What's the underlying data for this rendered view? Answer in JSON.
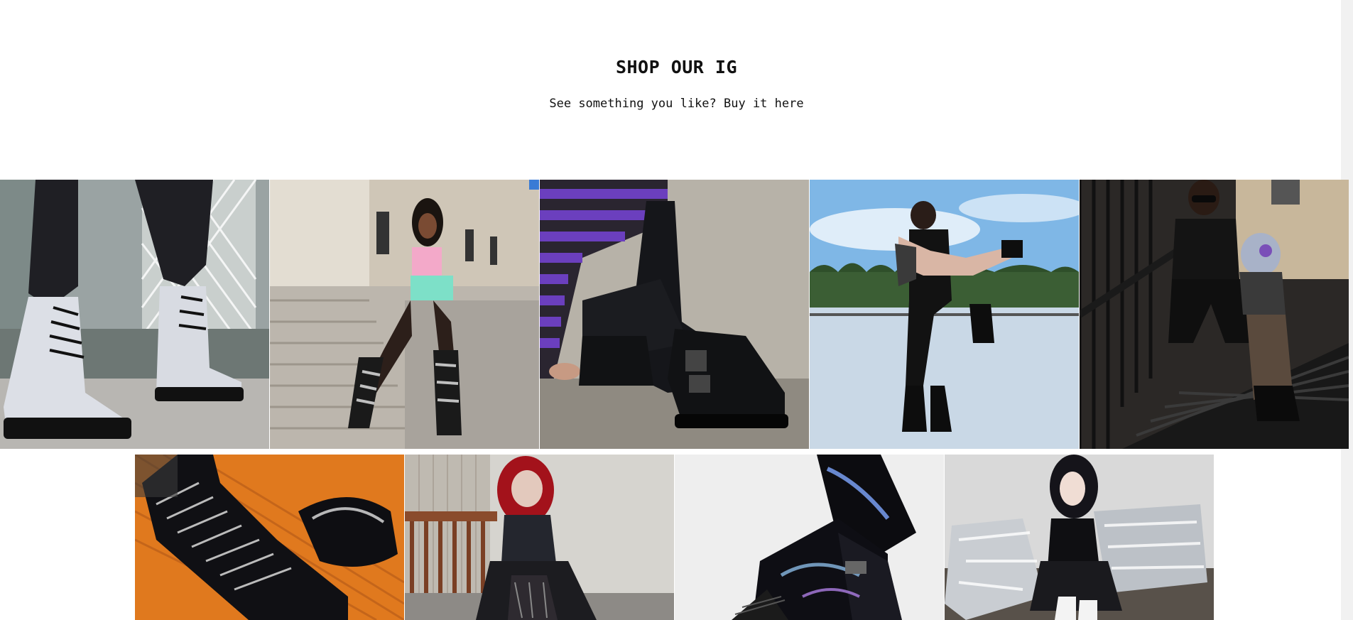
{
  "section": {
    "title": "SHOP OUR IG",
    "subtitle": "See something you like? Buy it here"
  },
  "gallery": {
    "posts": [
      {
        "id": "post-1",
        "icon": "photo-silver-glitter-boots"
      },
      {
        "id": "post-2",
        "icon": "photo-model-stairs-buckle-boots"
      },
      {
        "id": "post-3",
        "icon": "photo-striped-sweater-black-boots"
      },
      {
        "id": "post-4",
        "icon": "photo-couple-rooftop"
      },
      {
        "id": "post-5",
        "icon": "photo-couple-fire-escape"
      },
      {
        "id": "post-6",
        "icon": "photo-lace-up-patent-boots-orange"
      },
      {
        "id": "post-7",
        "icon": "photo-red-hair-model-porch"
      },
      {
        "id": "post-8",
        "icon": "photo-holographic-platform-boots"
      },
      {
        "id": "post-9",
        "icon": "photo-model-silver-pillows"
      }
    ]
  },
  "colors": {
    "background": "#ffffff",
    "text": "#111111",
    "scrollbar": "#f1f1f1"
  }
}
